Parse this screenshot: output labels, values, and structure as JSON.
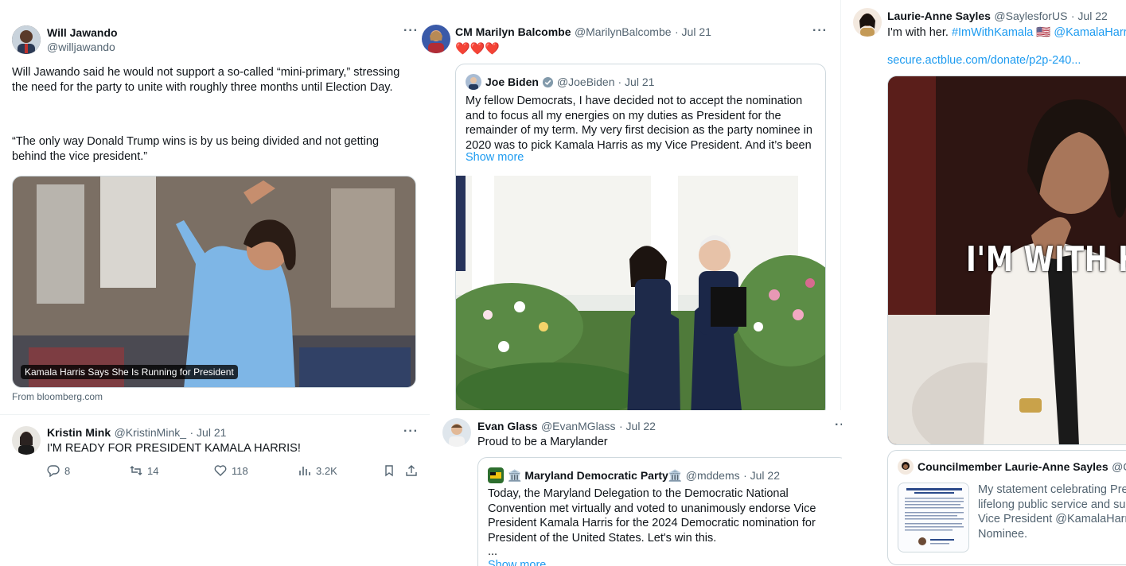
{
  "tweets": {
    "jawando": {
      "name": "Will Jawando",
      "handle": "@willjawando",
      "text_p1": "Will Jawando said he would not support a so-called “mini-primary,” stressing the need for the party to unite with roughly three months until Election Day.",
      "text_p2": "“The only way Donald Trump wins is by us being divided and not getting behind the vice president.”",
      "media_caption": "Kamala Harris Says She Is Running for President",
      "source": "From bloomberg.com"
    },
    "mink": {
      "name": "Kristin Mink",
      "handle": "@KristinMink_",
      "date": "· Jul 21",
      "text": "I'M READY FOR PRESIDENT KAMALA HARRIS!",
      "replies": "8",
      "reposts": "14",
      "likes": "118",
      "views": "3.2K"
    },
    "balcombe": {
      "name": "CM Marilyn Balcombe",
      "handle": "@MarilynBalcombe",
      "date": "· Jul 21",
      "text": "❤️❤️❤️",
      "quote": {
        "name": "Joe Biden",
        "handle": "@JoeBiden",
        "date": "· Jul 21",
        "text": "My fellow Democrats, I have decided not to accept the nomination and to focus all my energies on my duties as President for the remainder of my term. My very first decision as the party nominee in 2020 was to pick Kamala Harris as my Vice President. And it’s been the best",
        "show_more": "Show more"
      }
    },
    "glass": {
      "name": "Evan Glass",
      "handle": "@EvanMGlass",
      "date": "· Jul 22",
      "text": "Proud to be a Marylander",
      "quote": {
        "name": "🏛️ Maryland Democratic Party🏛️",
        "handle": "@mddems",
        "date": "· Jul 22",
        "text": "Today, the Maryland Delegation to the Democratic National Convention met virtually and voted to unanimously endorse Vice President Kamala Harris for the 2024 Democratic nomination for President of the United States. Let's win this.",
        "ellipsis": "...",
        "show_more": "Show more"
      }
    },
    "sayles": {
      "name": "Laurie-Anne Sayles",
      "handle": "@SaylesforUS",
      "date": "· Jul 22",
      "text_plain": "I'm with her.",
      "hashtag": "#ImWithKamala",
      "flag": "🇺🇸",
      "mention": "@KamalaHarris",
      "link": "secure.actblue.com/donate/p2p-240...",
      "media_overlay": "I'M WITH H",
      "quote": {
        "name": "Councilmember Laurie-Anne Sayles",
        "handle": "@CM",
        "text": "My statement celebrating Pres lifelong public service and sub Vice President @KamalaHarris Nominee."
      }
    }
  },
  "colors": {
    "accent": "#1d9bf0",
    "verified": "#829aab",
    "text": "#0f1419",
    "muted": "#536471",
    "border": "#cfd9de"
  }
}
